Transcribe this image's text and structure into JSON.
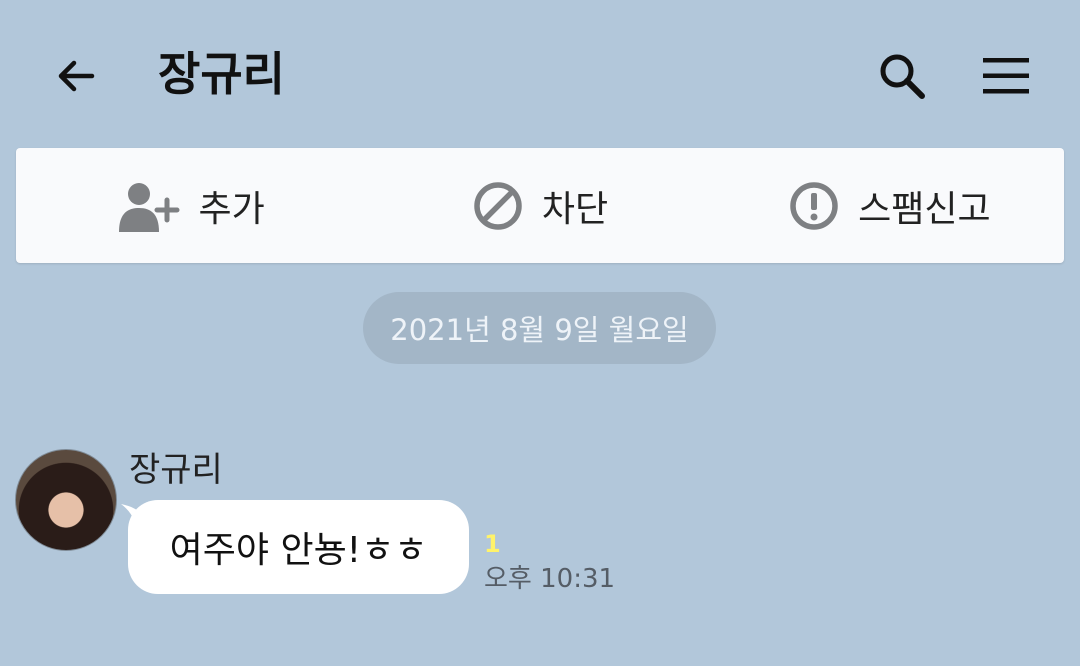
{
  "header": {
    "title": "장규리",
    "back_icon": "arrow-left-icon",
    "search_icon": "search-icon",
    "menu_icon": "hamburger-menu-icon"
  },
  "actions": [
    {
      "label": "추가",
      "icon": "add-friend-icon"
    },
    {
      "label": "차단",
      "icon": "block-icon"
    },
    {
      "label": "스팸신고",
      "icon": "alert-circle-icon"
    }
  ],
  "date_divider": "2021년 8월 9일 월요일",
  "message": {
    "sender": "장규리",
    "text": "여주야 안뇽!ㅎㅎ",
    "unread_count": "1",
    "time": "오후 10:31"
  },
  "colors": {
    "background": "#b2c7da",
    "card": "#f9fafc",
    "unread": "#fff36a"
  }
}
